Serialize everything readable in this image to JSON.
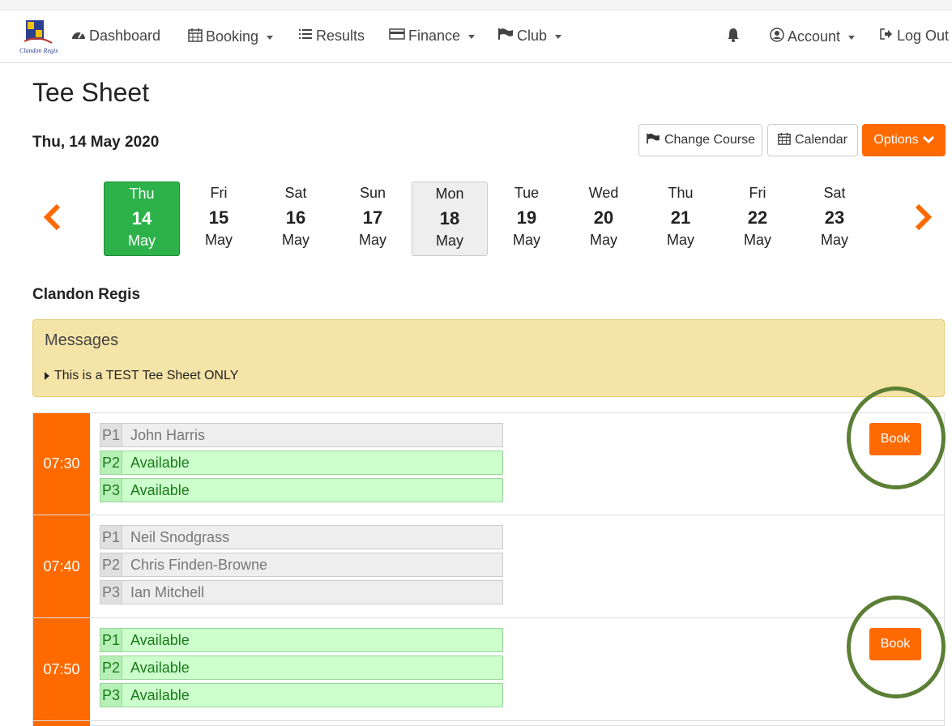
{
  "app": {
    "logo_text": "Clandon Regis"
  },
  "nav": {
    "dashboard": "Dashboard",
    "booking": "Booking",
    "results": "Results",
    "finance": "Finance",
    "club": "Club",
    "account": "Account",
    "logout": "Log Out"
  },
  "page": {
    "title": "Tee Sheet",
    "date": "Thu, 14 May 2020",
    "course": "Clandon Regis"
  },
  "toolbar": {
    "change_course": "Change Course",
    "calendar": "Calendar",
    "options": "Options"
  },
  "days": [
    {
      "name": "Thu",
      "num": "14",
      "month": "May"
    },
    {
      "name": "Fri",
      "num": "15",
      "month": "May"
    },
    {
      "name": "Sat",
      "num": "16",
      "month": "May"
    },
    {
      "name": "Sun",
      "num": "17",
      "month": "May"
    },
    {
      "name": "Mon",
      "num": "18",
      "month": "May"
    },
    {
      "name": "Tue",
      "num": "19",
      "month": "May"
    },
    {
      "name": "Wed",
      "num": "20",
      "month": "May"
    },
    {
      "name": "Thu",
      "num": "21",
      "month": "May"
    },
    {
      "name": "Fri",
      "num": "22",
      "month": "May"
    },
    {
      "name": "Sat",
      "num": "23",
      "month": "May"
    }
  ],
  "messages": {
    "title": "Messages",
    "items": [
      "This is a TEST Tee Sheet ONLY"
    ]
  },
  "slots": [
    {
      "time": "07:30",
      "book_label": "Book",
      "players": [
        {
          "pos": "P1",
          "name": "John Harris"
        },
        {
          "pos": "P2",
          "name": "Available"
        },
        {
          "pos": "P3",
          "name": "Available"
        }
      ]
    },
    {
      "time": "07:40",
      "players": [
        {
          "pos": "P1",
          "name": "Neil Snodgrass"
        },
        {
          "pos": "P2",
          "name": "Chris Finden-Browne"
        },
        {
          "pos": "P3",
          "name": "Ian Mitchell"
        }
      ]
    },
    {
      "time": "07:50",
      "book_label": "Book",
      "players": [
        {
          "pos": "P1",
          "name": "Available"
        },
        {
          "pos": "P2",
          "name": "Available"
        },
        {
          "pos": "P3",
          "name": "Available"
        }
      ]
    }
  ],
  "colors": {
    "accent": "#ff6a00",
    "selected_day": "#2db24a",
    "available_bg": "#ccffcc",
    "messages_bg": "#f5e4a8",
    "annotation_circle": "#5a7f35"
  },
  "icons": {
    "dashboard": "tachometer-icon",
    "booking": "calendar-icon",
    "results": "list-icon",
    "finance": "credit-card-icon",
    "club": "flag-icon",
    "notifications": "bell-icon",
    "account": "user-circle-icon",
    "logout": "sign-out-icon"
  }
}
